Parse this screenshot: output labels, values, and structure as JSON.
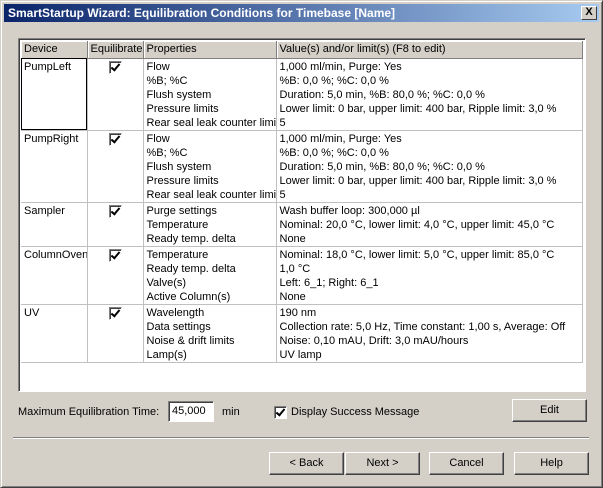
{
  "window": {
    "title": "SmartStartup Wizard: Equilibration Conditions for Timebase [Name]",
    "close_label": "X"
  },
  "grid": {
    "columns": [
      "Device",
      "Equilibrate",
      "Properties",
      "Value(s) and/or limit(s) (F8 to edit)"
    ],
    "rows": [
      {
        "device": "PumpLeft",
        "equilibrate": true,
        "properties": [
          "Flow",
          "%B; %C",
          "Flush system",
          "Pressure limits",
          "Rear seal leak counter limit"
        ],
        "values": [
          "1,000 ml/min, Purge: Yes",
          "%B: 0,0 %; %C: 0,0 %",
          "Duration: 5,0 min, %B: 80,0 %; %C: 0,0 %",
          "Lower limit: 0 bar, upper limit: 400 bar, Ripple limit: 3,0 %",
          "5"
        ]
      },
      {
        "device": "PumpRight",
        "equilibrate": true,
        "properties": [
          "Flow",
          "%B; %C",
          "Flush system",
          "Pressure limits",
          "Rear seal leak counter limit"
        ],
        "values": [
          "1,000 ml/min, Purge: Yes",
          "%B: 0,0 %; %C: 0,0 %",
          "Duration: 5,0 min, %B: 80,0 %; %C: 0,0 %",
          "Lower limit: 0 bar, upper limit: 400 bar, Ripple limit: 3,0 %",
          "5"
        ]
      },
      {
        "device": "Sampler",
        "equilibrate": true,
        "properties": [
          "Purge settings",
          "Temperature",
          "Ready temp. delta"
        ],
        "values": [
          "Wash buffer loop: 300,000 µl",
          "Nominal: 20,0 °C, lower limit: 4,0 °C, upper limit: 45,0 °C",
          "None"
        ]
      },
      {
        "device": "ColumnOven",
        "equilibrate": true,
        "properties": [
          "Temperature",
          "Ready temp. delta",
          "Valve(s)",
          "Active Column(s)"
        ],
        "values": [
          "Nominal: 18,0 °C, lower limit: 5,0 °C, upper limit: 85,0 °C",
          "1,0 °C",
          "Left: 6_1; Right: 6_1",
          "None"
        ]
      },
      {
        "device": "UV",
        "equilibrate": true,
        "properties": [
          "Wavelength",
          "Data settings",
          "Noise & drift limits",
          "Lamp(s)"
        ],
        "values": [
          "190 nm",
          "Collection rate: 5,0 Hz, Time constant: 1,00 s, Average: Off",
          "Noise: 0,10 mAU, Drift: 3,0 mAU/hours",
          "UV lamp"
        ]
      }
    ]
  },
  "bottom": {
    "max_eq_label": "Maximum Equilibration Time:",
    "max_eq_value": "45,000",
    "unit": "min",
    "display_success_label": "Display Success Message",
    "display_success_checked": true,
    "edit_label": "Edit"
  },
  "buttons": {
    "back": "< Back",
    "next": "Next >",
    "cancel": "Cancel",
    "help": "Help"
  }
}
